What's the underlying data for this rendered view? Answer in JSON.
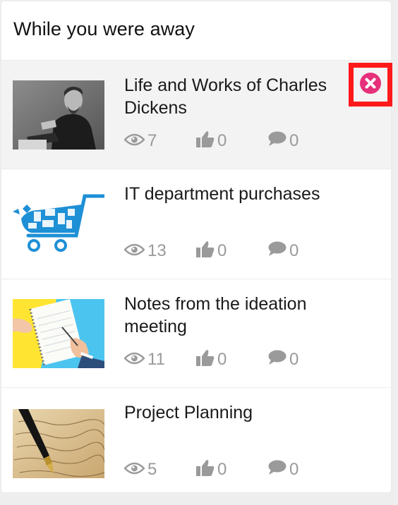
{
  "panel": {
    "title": "While you were away"
  },
  "items": [
    {
      "title": "Life and Works of Charles Dickens",
      "views": "7",
      "likes": "0",
      "comments": "0",
      "thumbnail": "portrait-photo",
      "highlighted": true
    },
    {
      "title": "IT department purchases",
      "views": "13",
      "likes": "0",
      "comments": "0",
      "thumbnail": "shopping-cart-devices"
    },
    {
      "title": "Notes from the ideation meeting",
      "views": "11",
      "likes": "0",
      "comments": "0",
      "thumbnail": "notebook-writing-photo"
    },
    {
      "title": "Project Planning",
      "views": "5",
      "likes": "0",
      "comments": "0",
      "thumbnail": "fountain-pen-letter-photo"
    }
  ],
  "icons": {
    "views": "eye-icon",
    "likes": "thumbs-up-icon",
    "comments": "speech-bubble-icon",
    "dismiss": "close-circle-icon"
  },
  "colors": {
    "dismiss_highlight": "#ff1a1a",
    "dismiss_icon": "#e6317a",
    "stat_text": "#9a9a9a"
  }
}
